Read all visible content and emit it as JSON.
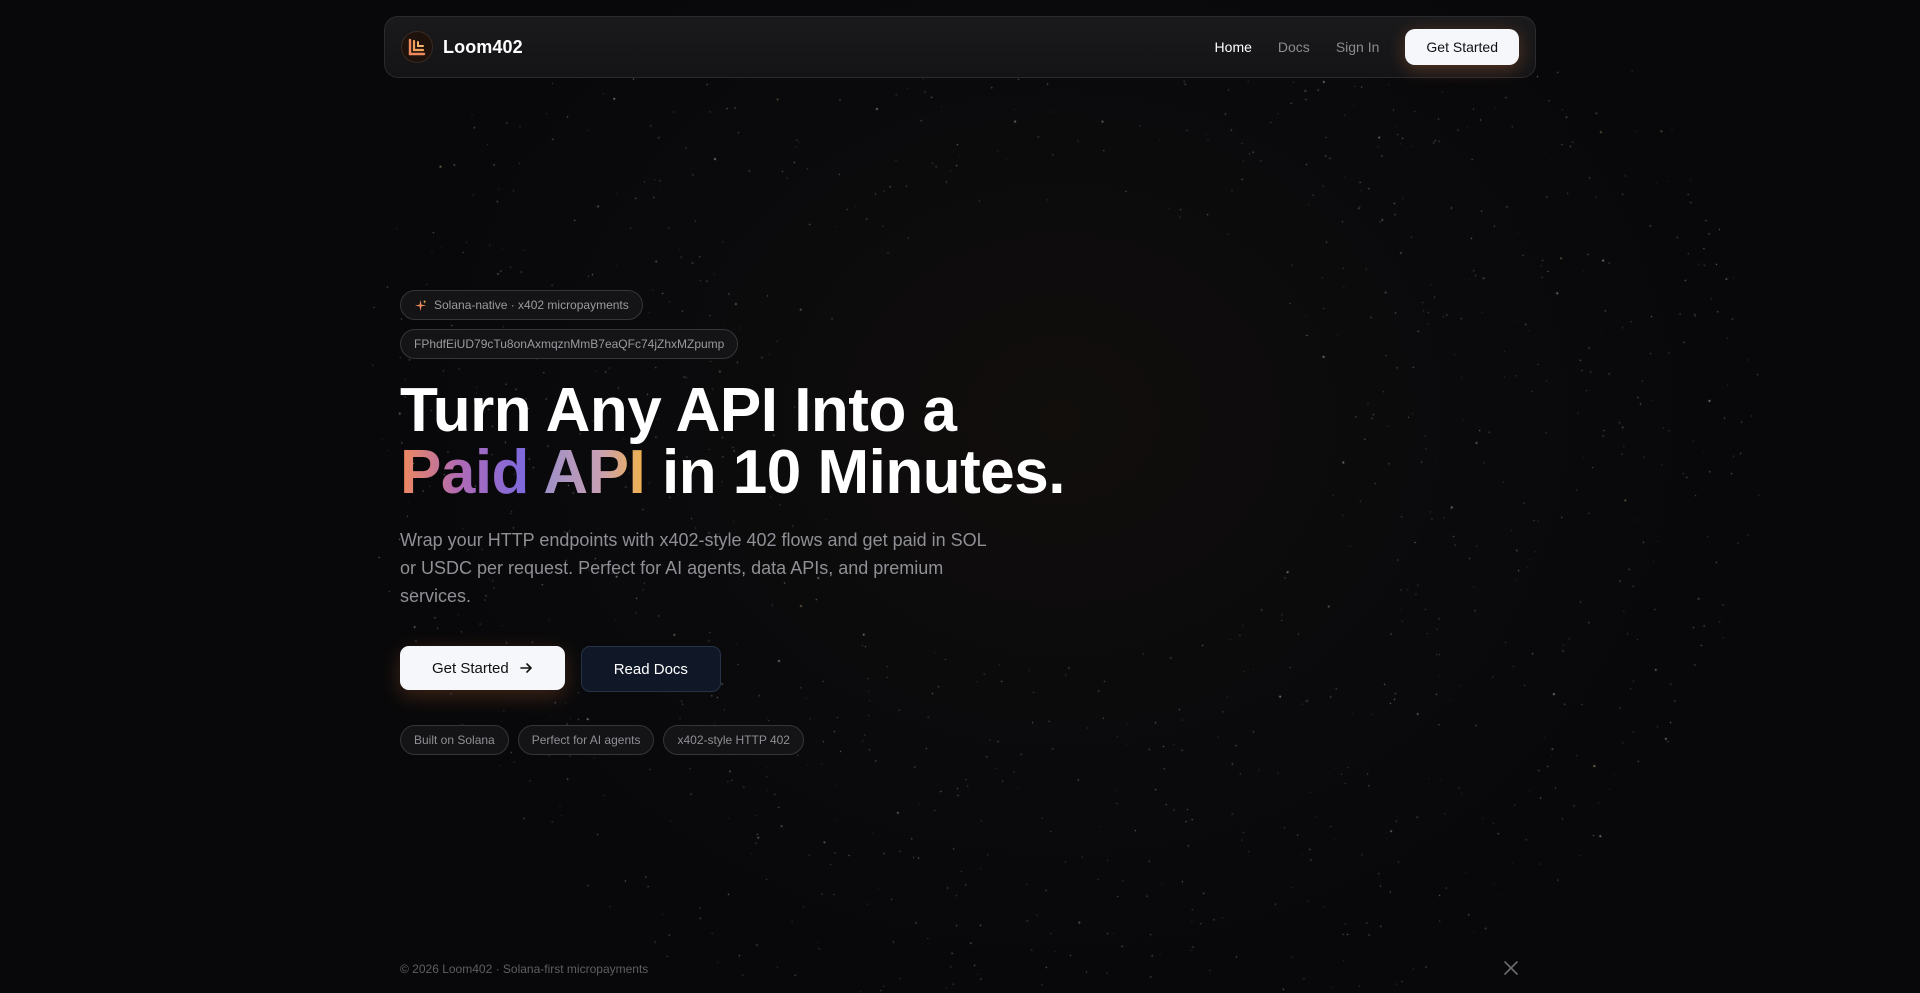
{
  "nav": {
    "brand": "Loom402",
    "links": [
      {
        "label": "Home",
        "active": true
      },
      {
        "label": "Docs",
        "active": false
      },
      {
        "label": "Sign In",
        "active": false
      }
    ],
    "cta": "Get Started"
  },
  "hero": {
    "badge": "Solana-native · x402 micropayments",
    "badge_icon": "sparkle-icon",
    "token_address": "FPhdfEiUD79cTu8onAxmqznMmB7eaQFc74jZhxMZpump",
    "title_line1": "Turn Any API Into a",
    "title_grad1": "Paid",
    "title_grad2": "API",
    "title_rest": "in 10 Minutes.",
    "subtitle": "Wrap your HTTP endpoints with x402-style 402 flows and get paid in SOL or USDC per request. Perfect for AI agents, data APIs, and premium services.",
    "primary_cta": "Get Started",
    "secondary_cta": "Read Docs",
    "tags": [
      "Built on Solana",
      "Perfect for AI agents",
      "x402-style HTTP 402"
    ]
  },
  "footer": {
    "text": "© 2026 Loom402 · Solana-first micropayments",
    "social_icon": "x-logo-icon"
  },
  "colors": {
    "background": "#08080a",
    "accent_orange": "#f08a5d",
    "accent_purple": "#7a6ae0",
    "accent_gold": "#f2b24a",
    "secondary_button": "#101828"
  }
}
